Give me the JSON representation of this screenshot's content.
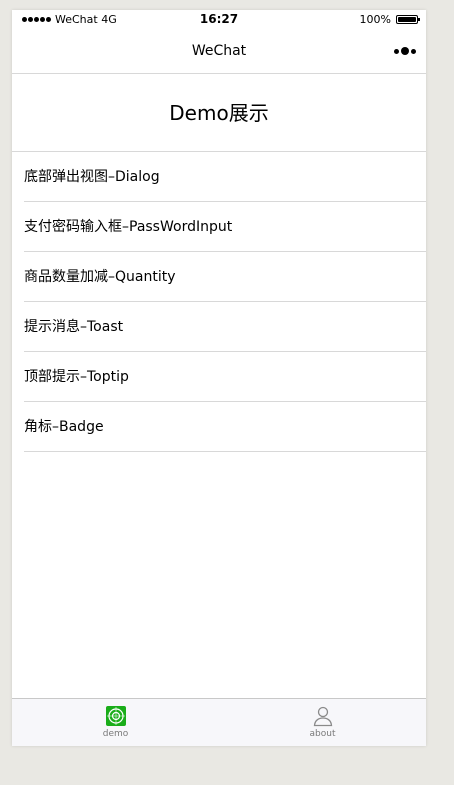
{
  "statusbar": {
    "carrier": "WeChat",
    "network": "4G",
    "time": "16:27",
    "battery": "100%",
    "battery_level": 1.0
  },
  "navbar": {
    "title": "WeChat"
  },
  "page": {
    "title": "Demo展示"
  },
  "list": [
    {
      "label": "底部弹出视图–Dialog"
    },
    {
      "label": "支付密码输入框–PassWordInput"
    },
    {
      "label": "商品数量加减–Quantity"
    },
    {
      "label": "提示消息–Toast"
    },
    {
      "label": "顶部提示–Toptip"
    },
    {
      "label": "角标–Badge"
    }
  ],
  "tabbar": {
    "tabs": [
      {
        "label": "demo",
        "icon": "demo-icon",
        "active": true
      },
      {
        "label": "about",
        "icon": "person-icon",
        "active": false
      }
    ]
  },
  "colors": {
    "background": "#e9e8e3",
    "divider": "#d8d8d8",
    "tab_active_icon": "#1aad19",
    "tab_label": "#7a7a7a"
  }
}
